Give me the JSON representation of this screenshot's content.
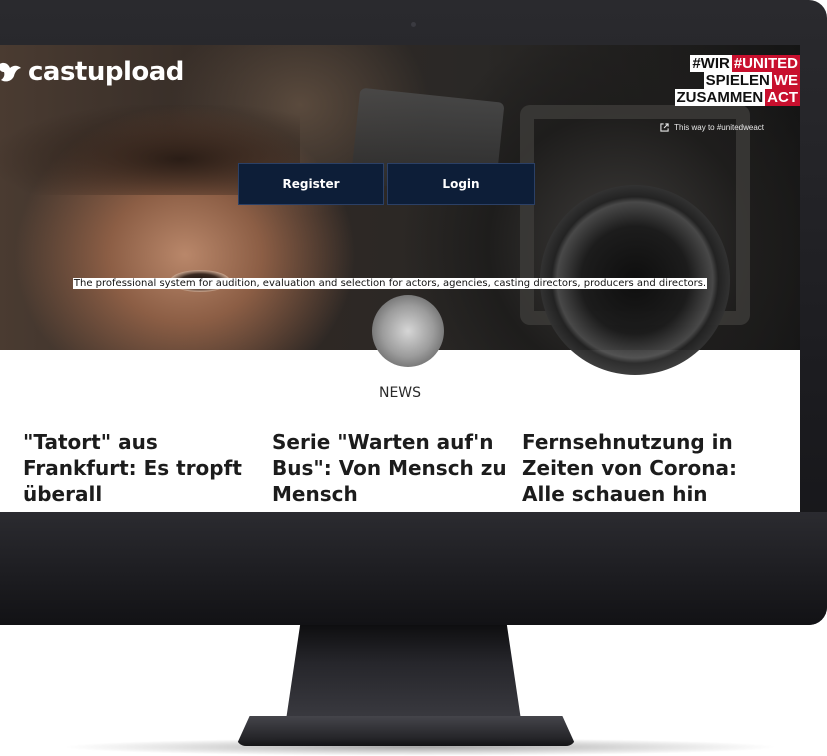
{
  "brand": {
    "logo_text": "castupload",
    "logo_icon": "bird-icon"
  },
  "campaign": {
    "rows": [
      {
        "white": "#WIR",
        "red": "#UNITED"
      },
      {
        "white": "SPIELEN",
        "red": "WE"
      },
      {
        "white": "ZUSAMMEN",
        "red": "ACT"
      }
    ],
    "link_text": "This way to #unitedweact",
    "link_icon": "external-link-icon"
  },
  "auth": {
    "register_label": "Register",
    "login_label": "Login"
  },
  "tagline": "The professional system for audition, evaluation and selection for actors, agencies, casting directors, producers and directors.",
  "news": {
    "heading": "NEWS",
    "items": [
      {
        "title": "\"Tatort\" aus Frankfurt: Es tropft überall"
      },
      {
        "title": "Serie \"Warten auf'n Bus\": Von Mensch zu Mensch"
      },
      {
        "title": "Fernsehnutzung in Zeiten von Corona: Alle schauen hin"
      }
    ]
  },
  "colors": {
    "button_bg": "#0d1e38",
    "campaign_red": "#c8102e",
    "monitor_bezel": "#1c1c20"
  }
}
